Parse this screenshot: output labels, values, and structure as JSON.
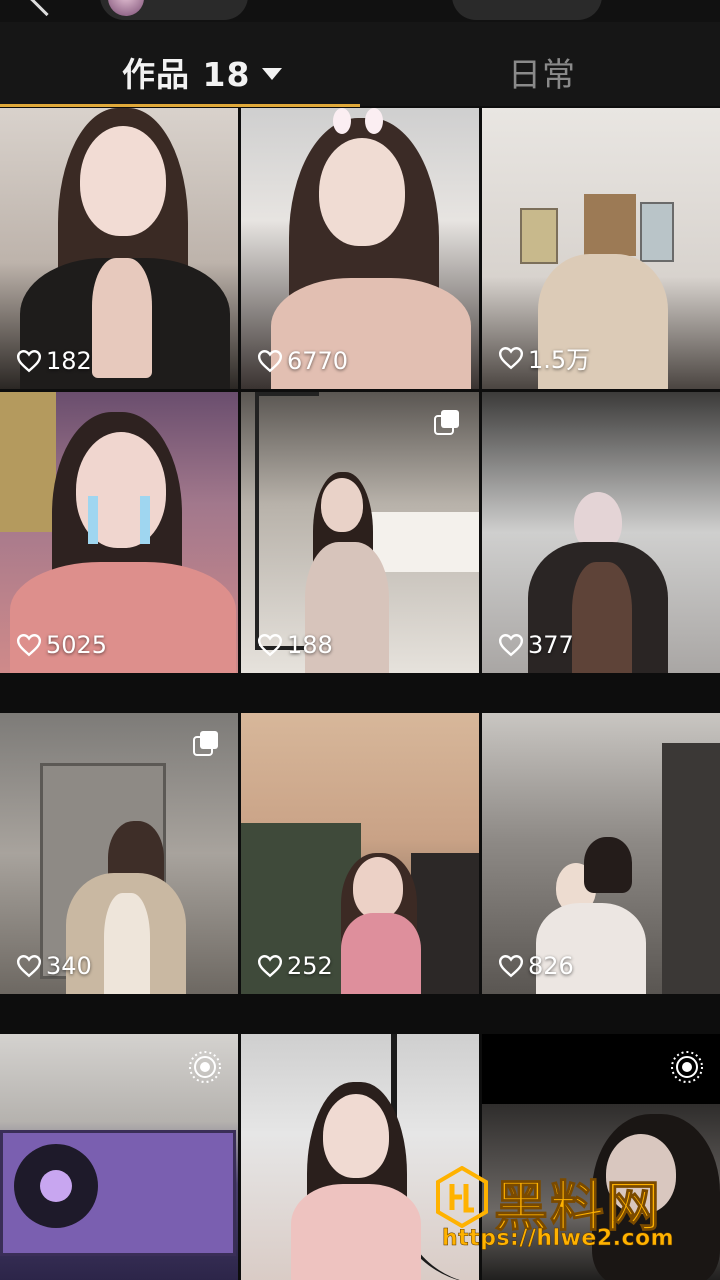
{
  "tabs": {
    "works_label": "作品 18",
    "daily_label": "日常",
    "accent": "#e0a93a"
  },
  "posts": [
    {
      "likes": "182",
      "badge": ""
    },
    {
      "likes": "6770",
      "badge": ""
    },
    {
      "likes": "1.5万",
      "badge": ""
    },
    {
      "likes": "5025",
      "badge": ""
    },
    {
      "likes": "188",
      "badge": "multi-image-icon"
    },
    {
      "likes": "377",
      "badge": ""
    },
    {
      "likes": "340",
      "badge": "multi-image-icon"
    },
    {
      "likes": "252",
      "badge": ""
    },
    {
      "likes": "826",
      "badge": ""
    },
    {
      "likes": "",
      "badge": "live-photo-icon"
    },
    {
      "likes": "",
      "badge": ""
    },
    {
      "likes": "",
      "badge": "live-photo-icon"
    }
  ],
  "watermark": {
    "name": "黑料网",
    "url": "https://hlwe2.com",
    "color": "#ffb200"
  }
}
